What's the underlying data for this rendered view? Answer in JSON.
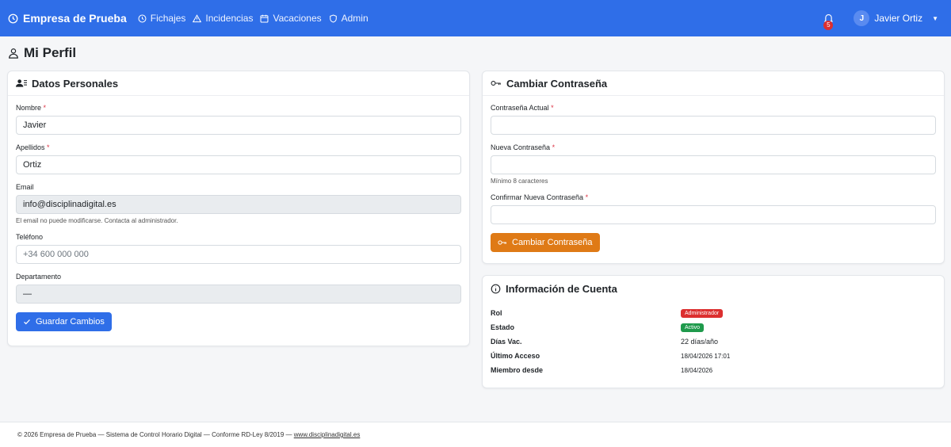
{
  "navbar": {
    "brand": "Empresa de Prueba",
    "items": [
      {
        "label": "Fichajes",
        "icon": "clock-icon"
      },
      {
        "label": "Incidencias",
        "icon": "warning-icon"
      },
      {
        "label": "Vacaciones",
        "icon": "calendar-icon"
      },
      {
        "label": "Admin",
        "icon": "shield-icon"
      }
    ],
    "notifications_count": "5",
    "user_initial": "J",
    "user_name": "Javier Ortiz"
  },
  "page": {
    "title": "Mi Perfil"
  },
  "personal": {
    "title": "Datos Personales",
    "nombre_label": "Nombre",
    "nombre_value": "Javier",
    "apellidos_label": "Apellidos",
    "apellidos_value": "Ortiz",
    "email_label": "Email",
    "email_value": "info@disciplinadigital.es",
    "email_help": "El email no puede modificarse. Contacta al administrador.",
    "telefono_label": "Teléfono",
    "telefono_placeholder": "+34 600 000 000",
    "departamento_label": "Departamento",
    "departamento_value": "—",
    "save_label": "Guardar Cambios",
    "required_mark": "*"
  },
  "password": {
    "title": "Cambiar Contraseña",
    "current_label": "Contraseña Actual",
    "new_label": "Nueva Contraseña",
    "new_help": "Mínimo 8 caracteres",
    "confirm_label": "Confirmar Nueva Contraseña",
    "button_label": "Cambiar Contraseña",
    "required_mark": "*"
  },
  "account": {
    "title": "Información de Cuenta",
    "rol_label": "Rol",
    "rol_value": "Administrador",
    "estado_label": "Estado",
    "estado_value": "Activo",
    "dias_label": "Días Vac.",
    "dias_value": "22 días/año",
    "acceso_label": "Último Acceso",
    "acceso_value": "18/04/2026 17:01",
    "miembro_label": "Miembro desde",
    "miembro_value": "18/04/2026"
  },
  "footer": {
    "text": "© 2026 Empresa de Prueba — Sistema de Control Horario Digital — Conforme RD-Ley 8/2019 —",
    "link": "www.disciplinadigital.es"
  },
  "colors": {
    "primary": "#2f6ee8",
    "warning": "#df7a16",
    "danger": "#dc2f2f",
    "success": "#1f9a4c"
  }
}
